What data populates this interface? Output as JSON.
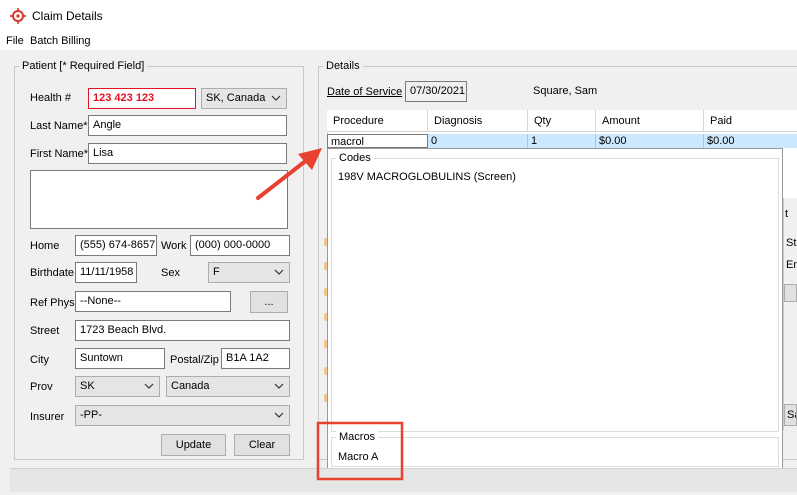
{
  "window": {
    "title": "Claim Details"
  },
  "menu": {
    "items": [
      "File",
      "Batch Billing"
    ]
  },
  "patient": {
    "group_title": "Patient [* Required Field]",
    "health_label": "Health #",
    "health_value": "123 423 123",
    "health_province": "SK, Canada",
    "last_name_label": "Last Name*",
    "last_name": "Angle",
    "first_name_label": "First Name*",
    "first_name": "Lisa",
    "home_label": "Home",
    "home_phone": "(555) 674-8657",
    "work_label": "Work",
    "work_phone": "(000) 000-0000",
    "birthdate_label": "Birthdate",
    "birthdate": "11/11/1958",
    "sex_label": "Sex",
    "sex": "F",
    "ref_phys_label": "Ref Phys",
    "ref_phys": "--None--",
    "ref_phys_browse": "...",
    "street_label": "Street",
    "street": "1723 Beach Blvd.",
    "city_label": "City",
    "city": "Suntown",
    "postal_label": "Postal/Zip",
    "postal": "B1A 1A2",
    "prov_label": "Prov",
    "prov": "SK",
    "country": "Canada",
    "insurer_label": "Insurer",
    "insurer": "-PP-",
    "update_button": "Update",
    "clear_button": "Clear"
  },
  "details": {
    "group_title": "Details",
    "dos_label": "Date of Service",
    "dos": "07/30/2021",
    "patient_name": "Square, Sam",
    "columns": [
      "Procedure",
      "Diagnosis",
      "Qty",
      "Amount",
      "Paid"
    ],
    "row": {
      "procedure": "macrol",
      "diagnosis": "0",
      "qty": "1",
      "amount": "$0.00",
      "paid": "$0.00"
    },
    "side_fragments": [
      "t",
      "St",
      "En",
      "Sa"
    ]
  },
  "codes_popup": {
    "group_title": "Codes",
    "items": [
      "198V MACROGLOBULINS (Screen)"
    ]
  },
  "macros_popup": {
    "group_title": "Macros",
    "items": [
      "Macro A"
    ]
  },
  "annotation": {
    "color": "#e8412f"
  }
}
